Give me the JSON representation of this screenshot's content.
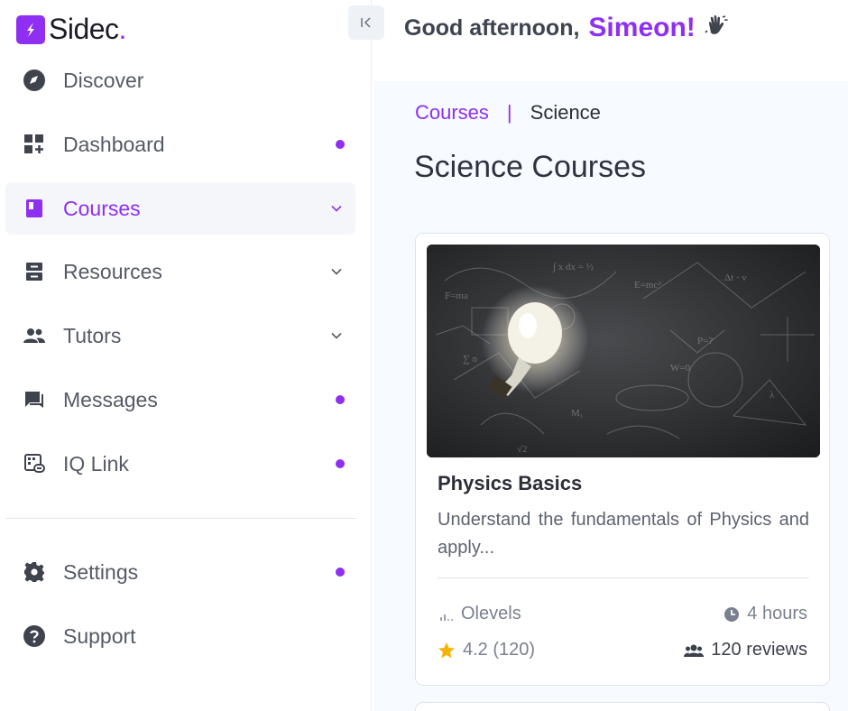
{
  "brand": {
    "name": "Sidec",
    "dot": "."
  },
  "greeting": {
    "text": "Good afternoon,",
    "name": "Simeon!",
    "emoji": "👋"
  },
  "sidebar": {
    "items": [
      {
        "label": "Discover",
        "icon": "compass-icon"
      },
      {
        "label": "Dashboard",
        "icon": "dashboard-icon",
        "dot": true
      },
      {
        "label": "Courses",
        "icon": "book-icon",
        "chevron": true,
        "active": true
      },
      {
        "label": "Resources",
        "icon": "storage-icon",
        "chevron": true
      },
      {
        "label": "Tutors",
        "icon": "users-icon",
        "chevron": true
      },
      {
        "label": "Messages",
        "icon": "chat-icon",
        "dot": true
      },
      {
        "label": "IQ Link",
        "icon": "link-icon",
        "dot": true
      }
    ],
    "bottom_items": [
      {
        "label": "Settings",
        "icon": "gear-icon",
        "dot": true
      },
      {
        "label": "Support",
        "icon": "help-icon"
      }
    ]
  },
  "breadcrumb": {
    "parent": "Courses",
    "separator": "|",
    "current": "Science"
  },
  "page_title": "Science Courses",
  "course": {
    "title": "Physics Basics",
    "description": "Understand the fundamentals of Physics and apply...",
    "level": "Olevels",
    "duration": "4 hours",
    "rating": "4.2 (120)",
    "reviews": "120 reviews"
  },
  "colors": {
    "accent": "#8e2ff2",
    "text": "#555a66",
    "active_bg": "#f4f6fa",
    "main_bg": "#f7fafe"
  }
}
